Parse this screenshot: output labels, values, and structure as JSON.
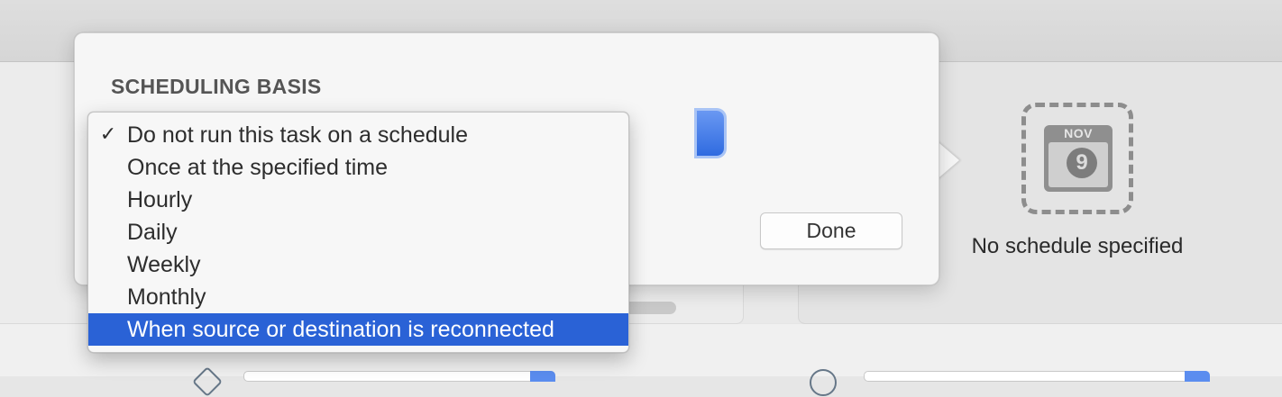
{
  "popover": {
    "section_title": "SCHEDULING BASIS",
    "done_label": "Done"
  },
  "menu": {
    "items": [
      {
        "label": "Do not run this task on a schedule",
        "checked": true,
        "highlighted": false
      },
      {
        "label": "Once at the specified time",
        "checked": false,
        "highlighted": false
      },
      {
        "label": "Hourly",
        "checked": false,
        "highlighted": false
      },
      {
        "label": "Daily",
        "checked": false,
        "highlighted": false
      },
      {
        "label": "Weekly",
        "checked": false,
        "highlighted": false
      },
      {
        "label": "Monthly",
        "checked": false,
        "highlighted": false
      },
      {
        "label": "When source or destination is reconnected",
        "checked": false,
        "highlighted": true
      }
    ],
    "check_glyph": "✓",
    "highlight_color": "#2a62d6"
  },
  "schedule_panel": {
    "calendar_month": "NOV",
    "calendar_day": "9",
    "status_text": "No schedule specified",
    "icon": "calendar-icon"
  },
  "colors": {
    "accent": "#2f6be0",
    "placeholder_border": "#8d8d8d"
  }
}
